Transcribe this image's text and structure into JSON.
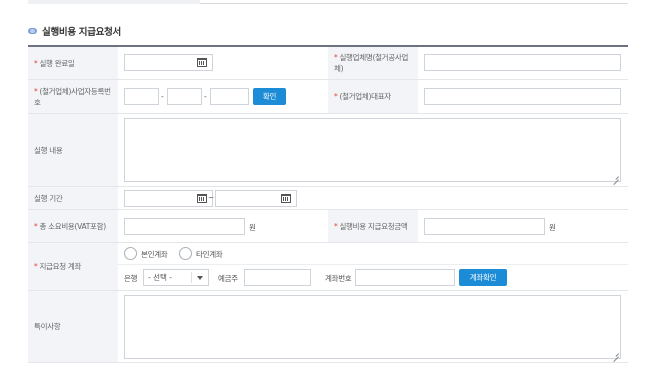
{
  "section": {
    "title": "실행비용 지급요청서"
  },
  "fields": {
    "completion_date": {
      "label": "실행 완료일",
      "required": "*"
    },
    "vendor_name": {
      "label": "실행업체명(철거공사업체)",
      "required": "*"
    },
    "biz_no": {
      "label": "(철거업체)사업자등록번호",
      "required": "*",
      "dash": "-",
      "confirm_button": "확인"
    },
    "representative": {
      "label": "(철거업체)대표자",
      "required": "*"
    },
    "content": {
      "label": "실행 내용"
    },
    "period": {
      "label": "실행 기간",
      "tilde": "~"
    },
    "total_cost": {
      "label": "총 소요비용(VAT포함)",
      "required": "*",
      "unit": "원"
    },
    "request_amount": {
      "label": "실행비용 지급요청금액",
      "required": "*",
      "unit": "원"
    },
    "account": {
      "label": "지급요청 계좌",
      "required": "*",
      "radio_own": "본인계좌",
      "radio_other": "타인계좌",
      "bank_label": "은행",
      "bank_select": "- 선택 -",
      "holder_label": "예금주",
      "number_label": "계좌번호",
      "verify_button": "계좌확인"
    },
    "notes": {
      "label": "특이사항"
    }
  }
}
